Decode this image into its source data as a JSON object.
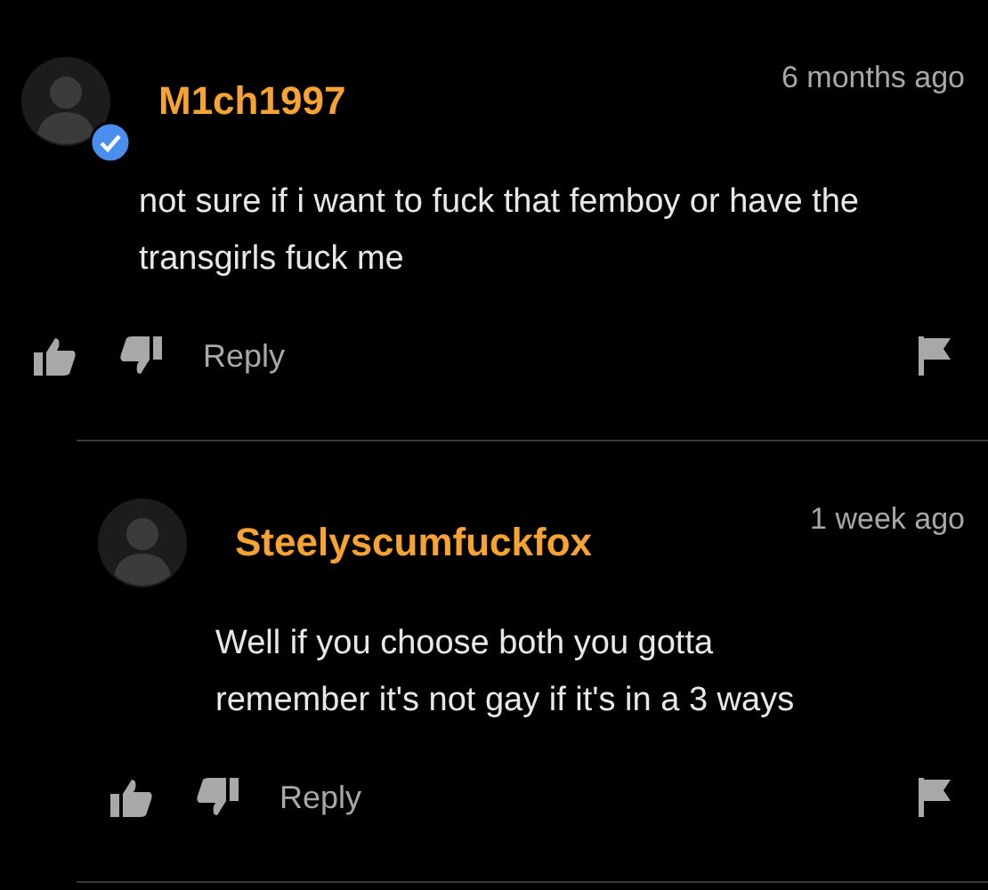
{
  "comments": [
    {
      "username": "M1ch1997",
      "verified": true,
      "time": "6 months ago",
      "text": "not sure if i want to fuck that femboy or have the transgirls fuck me",
      "reply_label": "Reply",
      "children": [
        {
          "username": "Steelyscumfuckfox",
          "verified": false,
          "time": "1 week ago",
          "text": "Well if you choose both you gotta remember it's not gay if it's in a 3 ways",
          "reply_label": "Reply"
        }
      ]
    }
  ]
}
